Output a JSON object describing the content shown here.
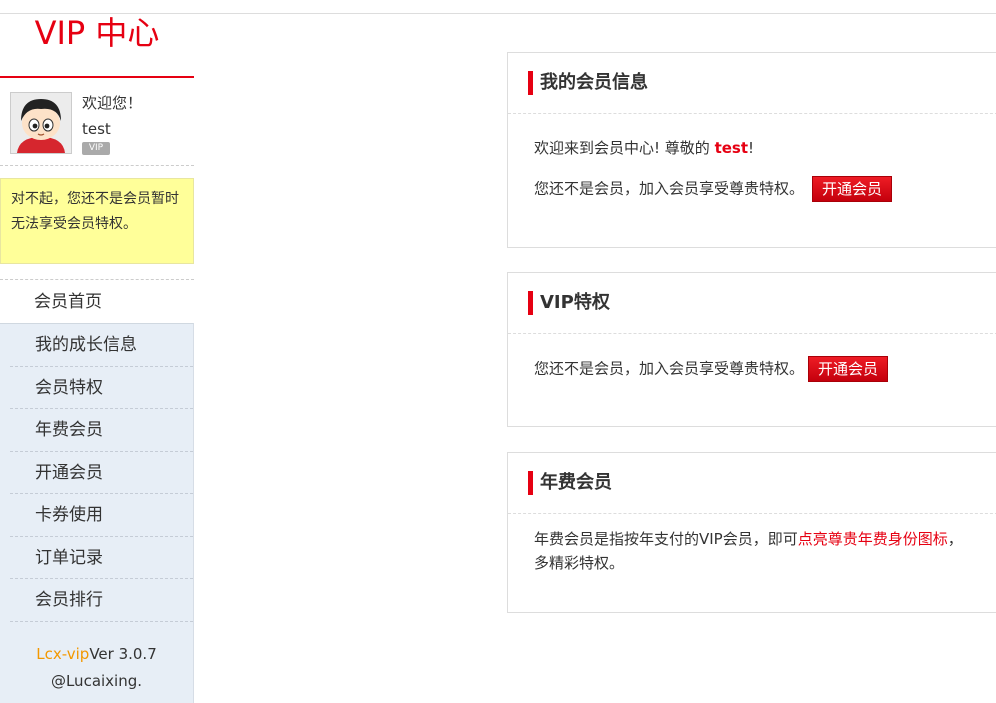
{
  "sidebar": {
    "brand": "VIP 中心",
    "user": {
      "welcome": "欢迎您！",
      "name": "test",
      "badge": "VIP"
    },
    "notice": "对不起，您还不是会员暂时无法享受会员特权。",
    "nav": {
      "home": "会员首页",
      "items": [
        "我的成长信息",
        "会员特权",
        "年费会员",
        "开通会员",
        "卡券使用",
        "订单记录",
        "会员排行"
      ]
    },
    "footer": {
      "brand": "Lcx-vip",
      "version": "Ver 3.0.7",
      "author": "@Lucaixing."
    }
  },
  "panels": {
    "info": {
      "title": "我的会员信息",
      "greeting_prefix": "欢迎来到会员中心! 尊敬的",
      "greeting_name": "test",
      "greeting_suffix": "!",
      "status_text": "您还不是会员，加入会员享受尊贵特权。",
      "button_label": "开通会员"
    },
    "privilege": {
      "title": "VIP特权",
      "status_text": "您还不是会员，加入会员享受尊贵特权。",
      "button_label": "开通会员"
    },
    "annual": {
      "title": "年费会员",
      "desc_prefix": "年费会员是指按年支付的VIP会员，即可",
      "desc_link": "点亮尊贵年费身份图标",
      "desc_suffix": "，",
      "desc_line2": "多精彩特权。"
    }
  },
  "colors": {
    "accent": "#e60012",
    "notice_bg": "#ffff99",
    "nav_bg": "#e7eef6",
    "footer_brand": "#f39800"
  },
  "icons": {
    "avatar": "cartoon-avatar"
  }
}
